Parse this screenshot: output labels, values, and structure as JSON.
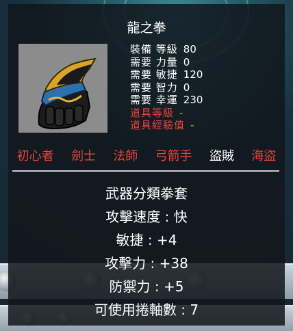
{
  "item": {
    "name": "龍之拳",
    "icon": "gold-black-claw-glove-icon"
  },
  "requirements": [
    {
      "label": "裝備 等級",
      "value": "80",
      "style": "normal"
    },
    {
      "label": "需要 力量",
      "value": "0",
      "style": "normal"
    },
    {
      "label": "需要 敏捷",
      "value": "120",
      "style": "normal"
    },
    {
      "label": "需要 智力",
      "value": "0",
      "style": "normal"
    },
    {
      "label": "需要 幸運",
      "value": "230",
      "style": "normal"
    },
    {
      "label": "道具等級",
      "value": "-",
      "style": "red"
    },
    {
      "label": "道具經驗值",
      "value": "-",
      "style": "red"
    }
  ],
  "jobs": [
    {
      "label": "初心者",
      "allowed": false
    },
    {
      "label": "劍士",
      "allowed": false
    },
    {
      "label": "法師",
      "allowed": false
    },
    {
      "label": "弓箭手",
      "allowed": false
    },
    {
      "label": "盜賊",
      "allowed": true
    },
    {
      "label": "海盜",
      "allowed": false
    }
  ],
  "properties": [
    "武器分類拳套",
    "攻擊速度 : 快",
    "敏捷 : +4",
    "攻擊力 : +38",
    "防禦力 : +5",
    "可使用捲軸數 : 7"
  ]
}
